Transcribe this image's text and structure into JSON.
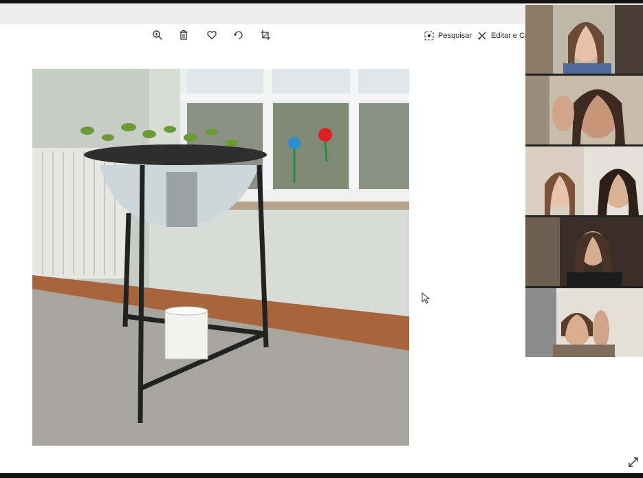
{
  "toolbar": {
    "zoom_icon": "zoom-in-icon",
    "delete_icon": "trash-icon",
    "favorite_icon": "heart-icon",
    "rotate_icon": "rotate-icon",
    "crop_icon": "crop-icon",
    "search_label": "Pesquisar",
    "edit_label": "Editar e Cri"
  },
  "photo": {
    "description_icon": "photo-image"
  },
  "participants": {
    "tiles": [
      {
        "id": "participant-1"
      },
      {
        "id": "participant-2"
      },
      {
        "id": "participant-3"
      },
      {
        "id": "participant-4"
      },
      {
        "id": "participant-5"
      }
    ]
  },
  "colors": {
    "titlebar": "#eeeeee",
    "background": "#ffffff",
    "frame": "#111111"
  }
}
